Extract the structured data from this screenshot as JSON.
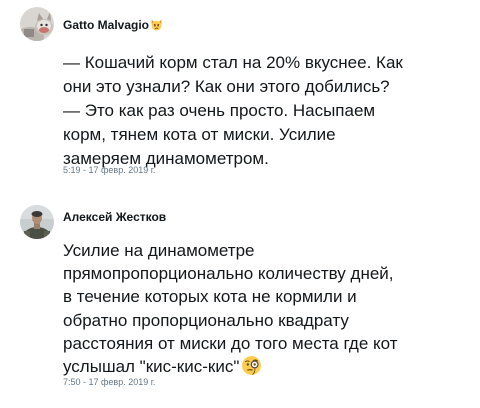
{
  "tweets": [
    {
      "author": "Gatto Malvagio",
      "author_emoji": "pouting-cat-emoji",
      "text": "— Кошачий корм стал на 20% вкуснее. Как\nони это узнали? Как они этого добились?\n— Это как раз очень просто. Насыпаем\nкорм, тянем кота от миски. Усилие\nзамеряем динамометром.",
      "timestamp": "5:19 - 17 февр. 2019 г."
    },
    {
      "author": "Алексей Жестков",
      "text": "Усилие на динамометре\nпрямопропорционально количеству дней,\nв течение которых кота не кормили  и\nобратно пропорционально квадрату\nрасстояния от миски до того места где кот\nуслышал \"кис-кис-кис\"",
      "text_emoji": "monocle-face-emoji",
      "timestamp": "7:50 - 17 февр. 2019 г."
    }
  ]
}
